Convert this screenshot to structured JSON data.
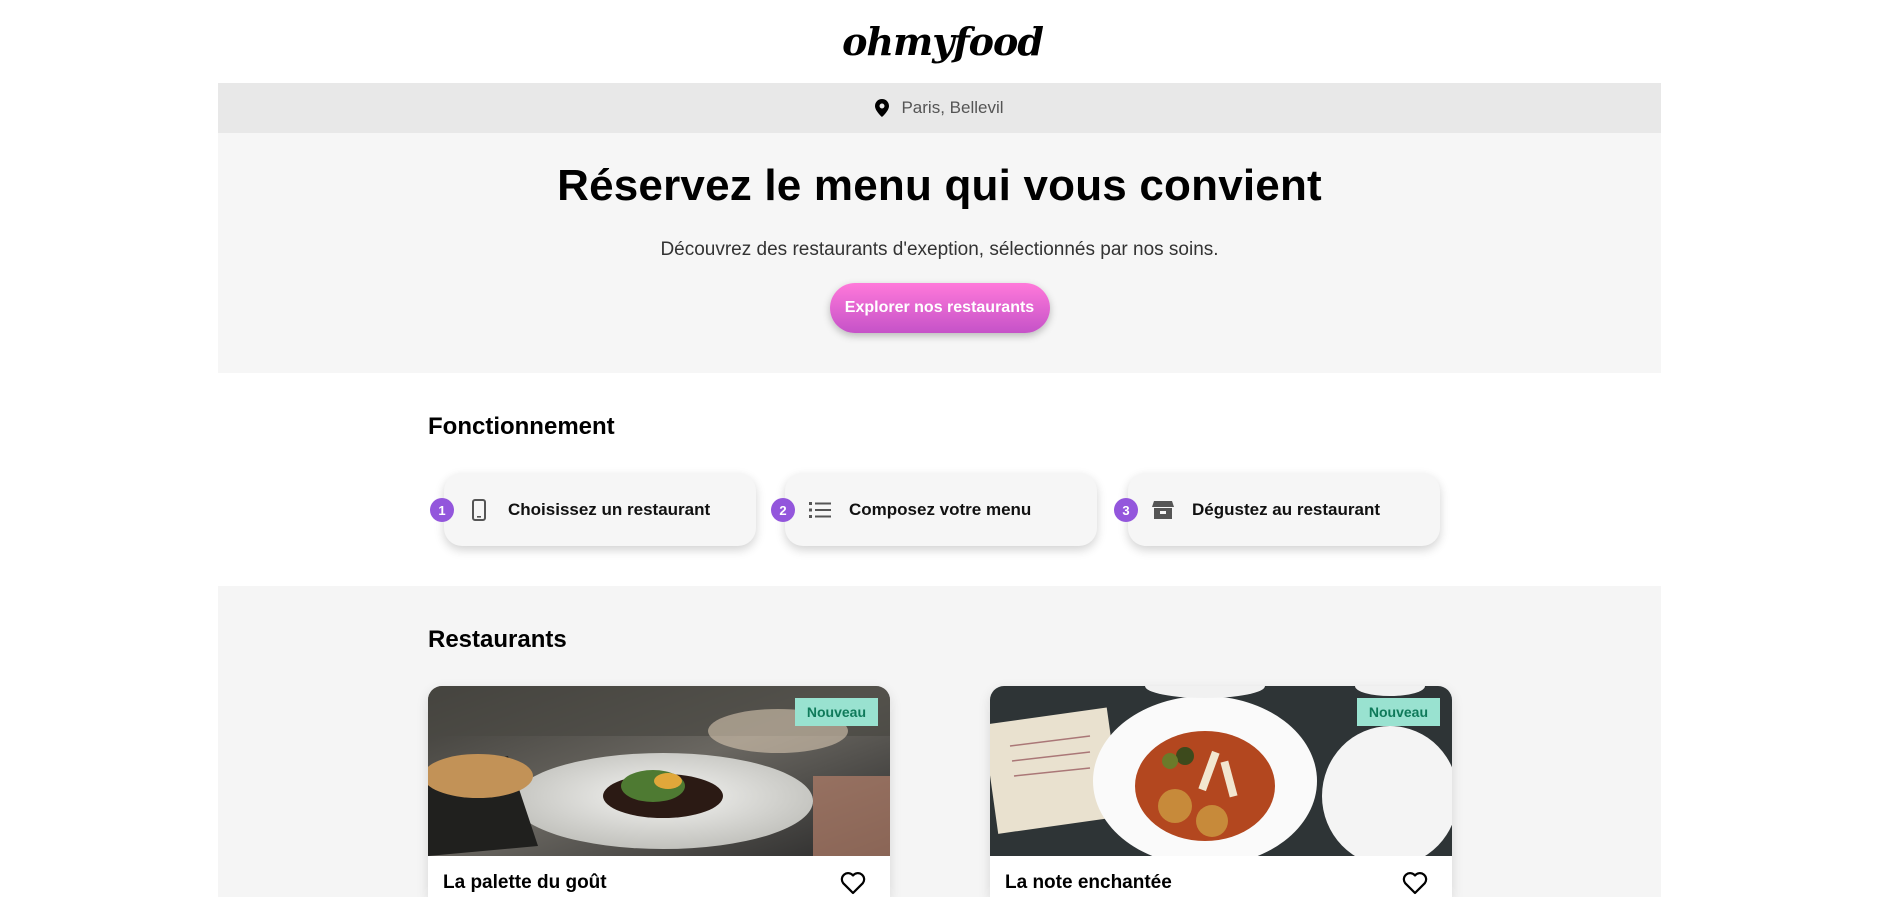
{
  "header": {
    "logo": "ohmyfood"
  },
  "location": {
    "text": "Paris, Bellevil",
    "icon": "map-pin-icon"
  },
  "hero": {
    "title": "Réservez le menu qui vous convient",
    "subtitle": "Découvrez des restaurants d'exeption, sélectionnés par nos soins.",
    "cta_label": "Explorer nos restaurants"
  },
  "how_it_works": {
    "title": "Fonctionnement",
    "steps": [
      {
        "number": "1",
        "label": "Choisissez un restaurant",
        "icon": "mobile-phone-icon"
      },
      {
        "number": "2",
        "label": "Composez votre menu",
        "icon": "list-icon"
      },
      {
        "number": "3",
        "label": "Dégustez au restaurant",
        "icon": "store-icon"
      }
    ]
  },
  "restaurants": {
    "title": "Restaurants",
    "items": [
      {
        "name": "La palette du goût",
        "badge": "Nouveau",
        "favorite_icon": "heart-icon"
      },
      {
        "name": "La note enchantée",
        "badge": "Nouveau",
        "favorite_icon": "heart-icon"
      }
    ]
  },
  "colors": {
    "accent_purple": "#9356dc",
    "cta_gradient_start": "#ff79da",
    "cta_gradient_end": "#c552c8",
    "badge_bg": "#99e2d0",
    "badge_text": "#0f7a5a"
  }
}
